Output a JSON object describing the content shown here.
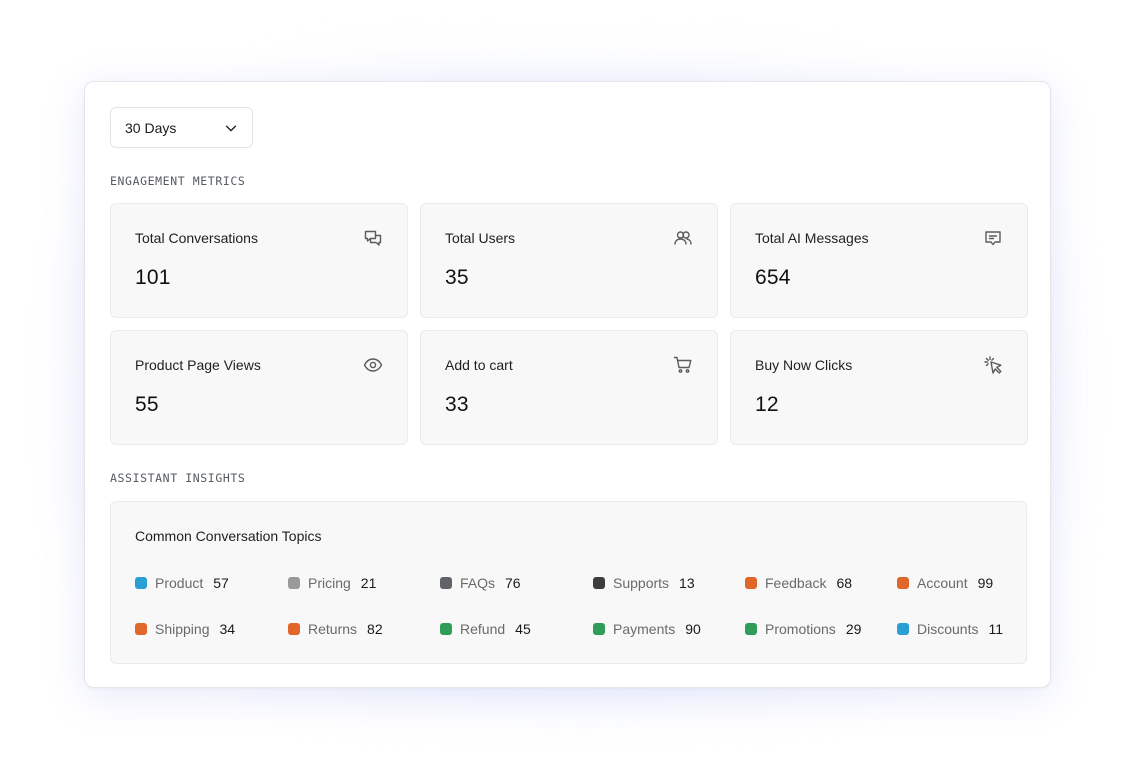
{
  "range_selector": {
    "value": "30 Days"
  },
  "sections": {
    "engagement": "ENGAGEMENT METRICS",
    "insights": "ASSISTANT INSIGHTS"
  },
  "metrics": [
    {
      "title": "Total Conversations",
      "value": "101",
      "icon": "chat-bubbles-icon"
    },
    {
      "title": "Total Users",
      "value": "35",
      "icon": "users-icon"
    },
    {
      "title": "Total AI Messages",
      "value": "654",
      "icon": "message-icon"
    },
    {
      "title": "Product Page Views",
      "value": "55",
      "icon": "eye-icon"
    },
    {
      "title": "Add to cart",
      "value": "33",
      "icon": "cart-icon"
    },
    {
      "title": "Buy Now Clicks",
      "value": "12",
      "icon": "cursor-click-icon"
    }
  ],
  "topics_card": {
    "title": "Common Conversation Topics",
    "topics": [
      {
        "name": "Product",
        "count": "57",
        "color": "#2a9fd6"
      },
      {
        "name": "Pricing",
        "count": "21",
        "color": "#9a9a9a"
      },
      {
        "name": "FAQs",
        "count": "76",
        "color": "#5f6368"
      },
      {
        "name": "Supports",
        "count": "13",
        "color": "#3d3d3d"
      },
      {
        "name": "Feedback",
        "count": "68",
        "color": "#e0662a"
      },
      {
        "name": "Account",
        "count": "99",
        "color": "#e0662a"
      },
      {
        "name": "Shipping",
        "count": "34",
        "color": "#e0662a"
      },
      {
        "name": "Returns",
        "count": "82",
        "color": "#e0662a"
      },
      {
        "name": "Refund",
        "count": "45",
        "color": "#2f9d57"
      },
      {
        "name": "Payments",
        "count": "90",
        "color": "#2f9d57"
      },
      {
        "name": "Promotions",
        "count": "29",
        "color": "#2f9d57"
      },
      {
        "name": "Discounts",
        "count": "11",
        "color": "#2a9fd6"
      }
    ]
  }
}
